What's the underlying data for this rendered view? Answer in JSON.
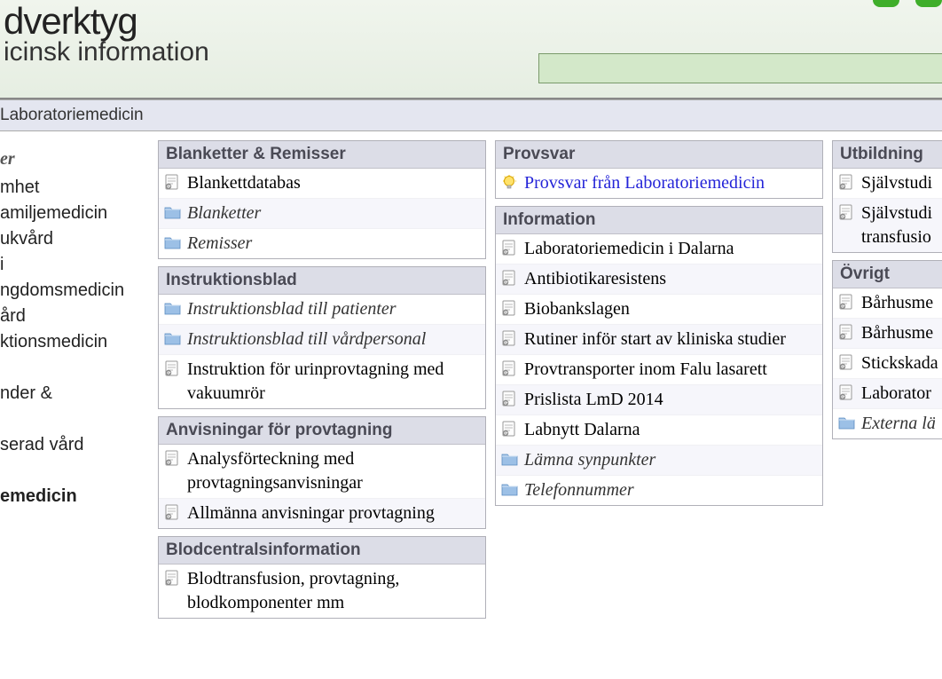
{
  "header": {
    "title_fragment": "dverktyg",
    "subtitle_fragment": "icinsk information"
  },
  "breadcrumb": "Laboratoriemedicin",
  "sidebar": {
    "heading": "er",
    "items": [
      "mhet",
      "amiljemedicin",
      "ukvård",
      "i",
      "ngdomsmedicin",
      "ård",
      "ktionsmedicin",
      "",
      "nder &",
      "",
      "serad vård",
      "",
      "emedicin"
    ]
  },
  "col1": {
    "panels": [
      {
        "title": "Blanketter & Remisser",
        "items": [
          {
            "type": "doc",
            "label": "Blankettdatabas"
          },
          {
            "type": "folder",
            "label": "Blanketter"
          },
          {
            "type": "folder",
            "label": "Remisser"
          }
        ]
      },
      {
        "title": "Instruktionsblad",
        "items": [
          {
            "type": "folder",
            "label": "Instruktionsblad till patienter"
          },
          {
            "type": "folder",
            "label": "Instruktionsblad till vårdpersonal"
          },
          {
            "type": "doc",
            "label": "Instruktion för urinprovtagning med vakuumrör"
          }
        ]
      },
      {
        "title": "Anvisningar för provtagning",
        "items": [
          {
            "type": "doc",
            "label": "Analysförteckning med provtagningsanvisningar"
          },
          {
            "type": "doc",
            "label": "Allmänna anvisningar provtagning"
          }
        ]
      },
      {
        "title": "Blodcentralsinformation",
        "items": [
          {
            "type": "doc",
            "label": "Blodtransfusion, provtagning, blodkomponenter mm"
          }
        ]
      }
    ]
  },
  "col2": {
    "panels": [
      {
        "title": "Provsvar",
        "items": [
          {
            "type": "bulb",
            "label": "Provsvar från Laboratoriemedicin",
            "link": true
          }
        ]
      },
      {
        "title": "Information",
        "items": [
          {
            "type": "doc",
            "label": "Laboratoriemedicin i Dalarna"
          },
          {
            "type": "doc",
            "label": "Antibiotikaresistens"
          },
          {
            "type": "doc",
            "label": "Biobankslagen"
          },
          {
            "type": "doc",
            "label": "Rutiner inför start av kliniska studier"
          },
          {
            "type": "doc",
            "label": "Provtransporter inom Falu lasarett"
          },
          {
            "type": "doc",
            "label": "Prislista LmD 2014"
          },
          {
            "type": "doc",
            "label": "Labnytt Dalarna"
          },
          {
            "type": "folder",
            "label": "Lämna synpunkter"
          },
          {
            "type": "folder",
            "label": "Telefonnummer"
          }
        ]
      }
    ]
  },
  "col3": {
    "panels": [
      {
        "title": "Utbildning",
        "items": [
          {
            "type": "doc",
            "label": "Självstudi"
          },
          {
            "type": "doc",
            "label": "Självstudi transfusio"
          }
        ]
      },
      {
        "title": "Övrigt",
        "items": [
          {
            "type": "doc",
            "label": "Bårhusme"
          },
          {
            "type": "doc",
            "label": "Bårhusme"
          },
          {
            "type": "doc",
            "label": "Stickskada"
          },
          {
            "type": "doc",
            "label": "Laborator"
          },
          {
            "type": "folder",
            "label": "Externa lä"
          }
        ]
      }
    ]
  }
}
